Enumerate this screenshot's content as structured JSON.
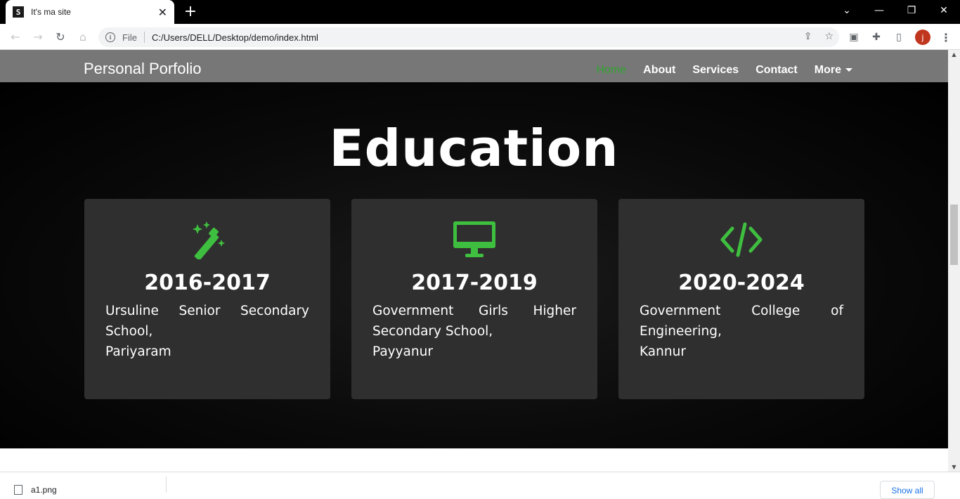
{
  "browser": {
    "tab_title": "It's ma site",
    "tab_favicon": "S",
    "new_tab": "+",
    "file_label": "File",
    "url": "C:/Users/DELL/Desktop/demo/index.html",
    "avatar_letter": "j",
    "window_controls": {
      "minimize": "—",
      "restore": "❐",
      "close": "✕",
      "tabsearch": "⌄"
    }
  },
  "site": {
    "brand": "Personal Porfolio",
    "nav": {
      "home": "Home",
      "about": "About",
      "services": "Services",
      "contact": "Contact",
      "more": "More"
    },
    "section_title": "Education",
    "cards": [
      {
        "icon": "magic-wand-icon",
        "years": "2016-2017",
        "lines": [
          "Ursuline Senior Secondary",
          "School,",
          "Pariyaram"
        ]
      },
      {
        "icon": "monitor-icon",
        "years": "2017-2019",
        "lines": [
          "Government Girls Higher",
          "Secondary School,",
          "Payyanur"
        ]
      },
      {
        "icon": "code-icon",
        "years": "2020-2024",
        "lines": [
          "Government College of",
          "Engineering,",
          "Kannur"
        ]
      }
    ],
    "accent_color": "#3fbf3f",
    "active_nav_color": "#2ea52e"
  },
  "downloads": {
    "file_name": "a1.png",
    "show_all": "Show all"
  }
}
